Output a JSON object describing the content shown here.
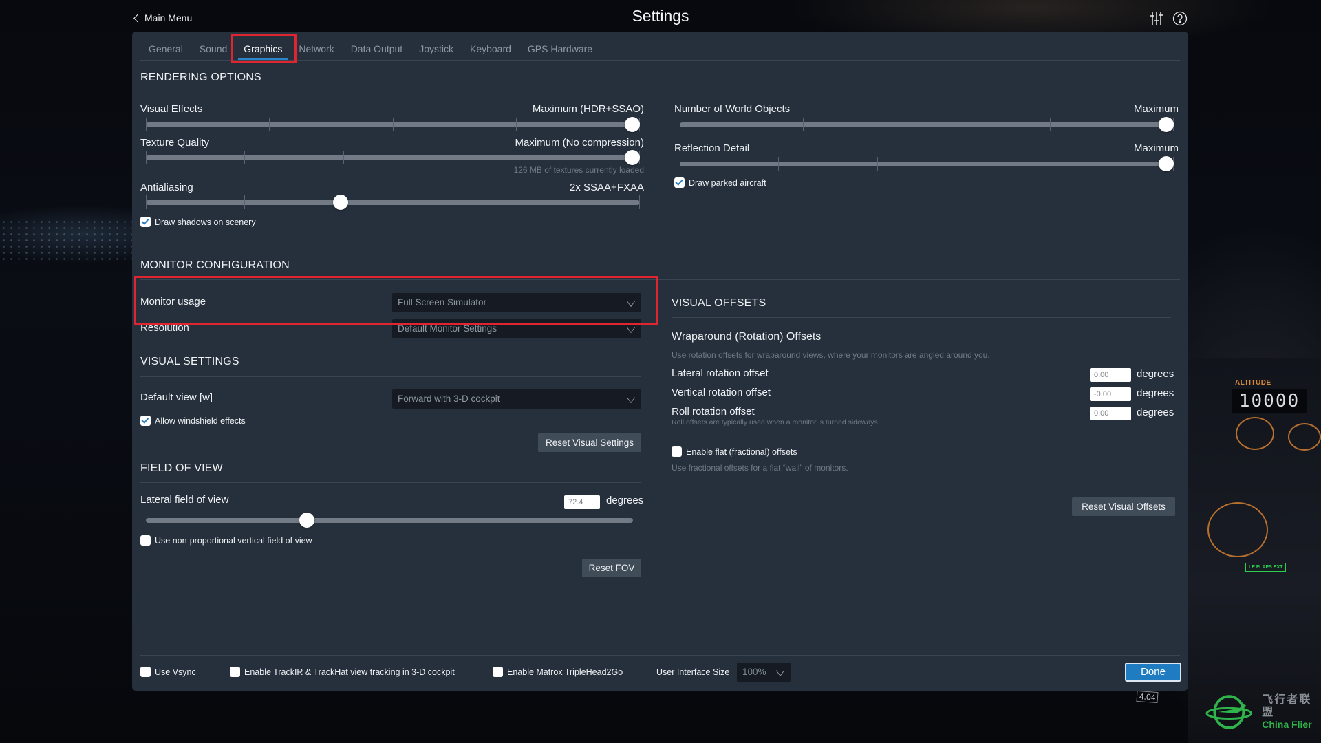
{
  "header": {
    "back_label": "Main Menu",
    "title": "Settings",
    "icons": [
      "sliders-icon",
      "help-icon"
    ]
  },
  "tabs": [
    {
      "label": "General",
      "active": false
    },
    {
      "label": "Sound",
      "active": false
    },
    {
      "label": "Graphics",
      "active": true
    },
    {
      "label": "Network",
      "active": false
    },
    {
      "label": "Data Output",
      "active": false
    },
    {
      "label": "Joystick",
      "active": false
    },
    {
      "label": "Keyboard",
      "active": false
    },
    {
      "label": "GPS Hardware",
      "active": false
    }
  ],
  "rendering": {
    "title": "RENDERING OPTIONS",
    "visual_effects": {
      "label": "Visual Effects",
      "value": "Maximum (HDR+SSAO)",
      "steps": 5,
      "position": 4
    },
    "texture_quality": {
      "label": "Texture Quality",
      "value": "Maximum (No compression)",
      "steps": 6,
      "position": 5,
      "note": "126 MB of textures currently loaded"
    },
    "antialiasing": {
      "label": "Antialiasing",
      "value": "2x SSAA+FXAA",
      "steps": 6,
      "position": 2
    },
    "draw_shadows": {
      "label": "Draw shadows on scenery",
      "checked": true
    },
    "world_objects": {
      "label": "Number of World Objects",
      "value": "Maximum",
      "steps": 5,
      "position": 4
    },
    "reflection_detail": {
      "label": "Reflection Detail",
      "value": "Maximum",
      "steps": 6,
      "position": 5
    },
    "draw_parked_aircraft": {
      "label": "Draw parked aircraft",
      "checked": true
    }
  },
  "monitor": {
    "title": "MONITOR CONFIGURATION",
    "monitor_usage": {
      "label": "Monitor usage",
      "value": "Full Screen Simulator"
    },
    "resolution": {
      "label": "Resolution",
      "value": "Default Monitor Settings"
    }
  },
  "visual_settings": {
    "title": "VISUAL SETTINGS",
    "default_view": {
      "label": "Default view [w]",
      "value": "Forward with 3-D cockpit"
    },
    "windshield": {
      "label": "Allow windshield effects",
      "checked": true
    },
    "reset_label": "Reset Visual Settings"
  },
  "fov": {
    "title": "FIELD OF VIEW",
    "lateral": {
      "label": "Lateral field of view",
      "value": "72.4",
      "unit": "degrees",
      "slider_fraction": 0.33
    },
    "non_proportional": {
      "label": "Use non-proportional vertical field of view",
      "checked": false
    },
    "reset_label": "Reset FOV"
  },
  "offsets": {
    "title": "VISUAL OFFSETS",
    "subtitle": "Wraparound (Rotation) Offsets",
    "description": "Use rotation offsets for wraparound views, where your monitors are angled around you.",
    "lateral": {
      "label": "Lateral rotation offset",
      "value": "0.00",
      "unit": "degrees"
    },
    "vertical": {
      "label": "Vertical rotation offset",
      "value": "-0.00",
      "unit": "degrees"
    },
    "roll": {
      "label": "Roll rotation offset",
      "value": "0.00",
      "unit": "degrees",
      "note": "Roll offsets are typically used when a monitor is turned sideways."
    },
    "flat": {
      "label": "Enable flat (fractional) offsets",
      "checked": false,
      "note": "Use fractional offsets for a flat “wall” of monitors."
    },
    "reset_label": "Reset Visual Offsets"
  },
  "footer": {
    "vsync": {
      "label": "Use Vsync",
      "checked": false
    },
    "trackir": {
      "label": "Enable TrackIR & TrackHat view tracking in 3-D cockpit",
      "checked": false
    },
    "matrox": {
      "label": "Enable Matrox TripleHead2Go",
      "checked": false
    },
    "ui_size_label": "User Interface Size",
    "ui_size_value": "100%",
    "done_label": "Done"
  },
  "background": {
    "altitude_label": "ALTITUDE",
    "altitude_value": "10000",
    "version_tag": "4.04",
    "watermark_cn": "飞行者联盟",
    "watermark_en": "China Flier"
  },
  "colors": {
    "accent": "#1f7cc1",
    "panel": "#26303d",
    "highlight": "#e02430",
    "checkmark": "#2f7fbf"
  }
}
